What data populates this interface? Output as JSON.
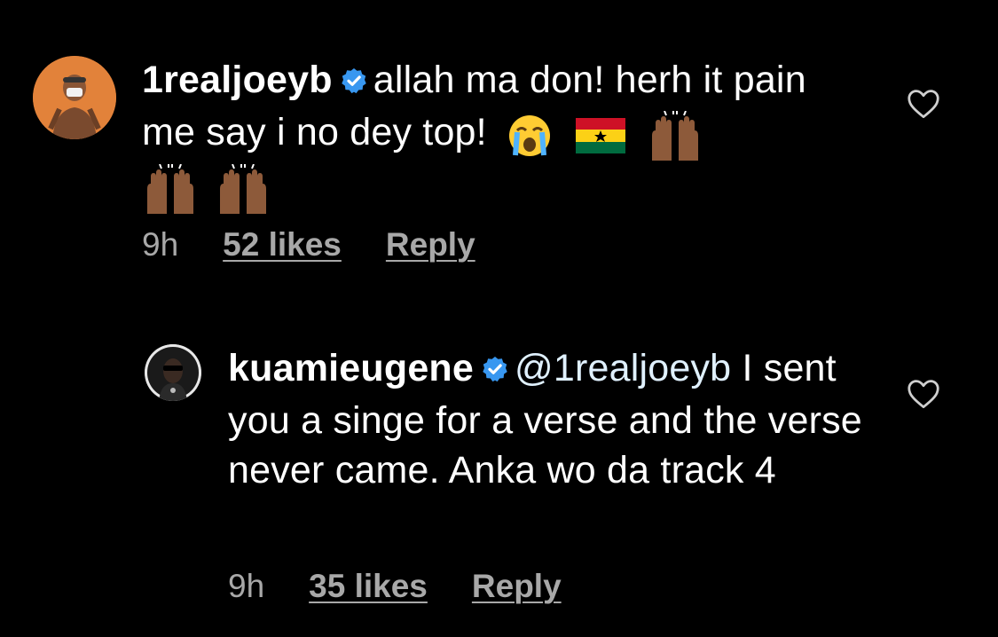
{
  "comments": [
    {
      "username": "1realjoeyb",
      "verified": true,
      "text": "allah ma don! herh it pain me say i no dey top!",
      "emojis": [
        "loudly-crying-face",
        "flag-ghana",
        "raising-hands",
        "raising-hands",
        "raising-hands"
      ],
      "time": "9h",
      "likes": "52 likes",
      "reply_label": "Reply"
    },
    {
      "username": "kuamieugene",
      "verified": true,
      "mention": "@1realjoeyb",
      "text": "I sent you a singe for a verse and the verse never came. Anka wo da track 4",
      "time": "9h",
      "likes": "35 likes",
      "reply_label": "Reply"
    }
  ],
  "colors": {
    "background": "#000000",
    "verified_badge": "#3897f0",
    "meta_text": "#a8a8a8",
    "mention": "#e0f1ff"
  },
  "icons": {
    "verified": "verified-badge-icon",
    "heart": "heart-outline-icon"
  }
}
